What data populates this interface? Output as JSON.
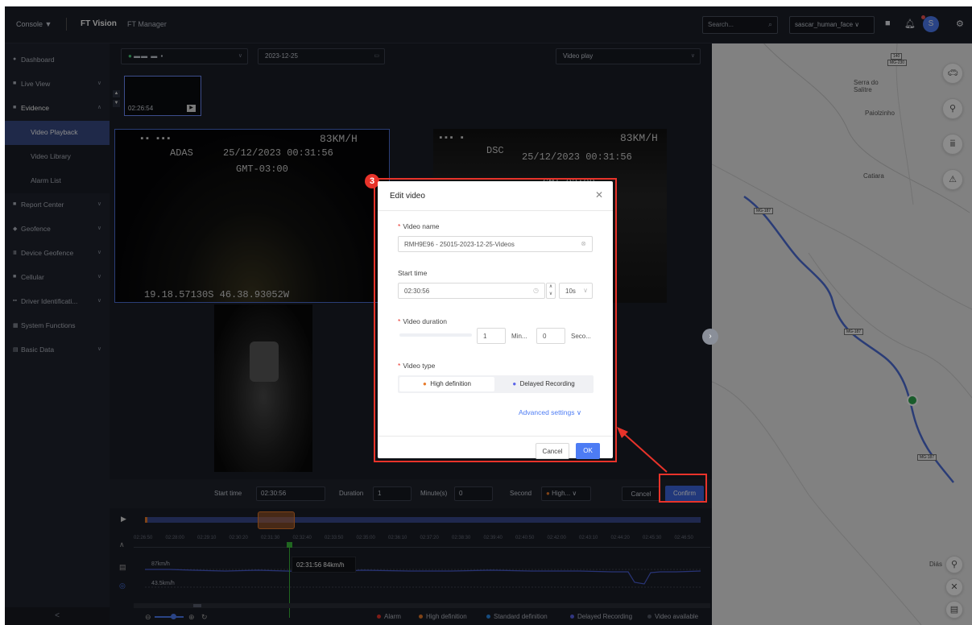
{
  "topbar": {
    "console": "Console ▼",
    "ft_vision": "FT Vision",
    "ft_manager": "FT Manager",
    "search_placeholder": "Search...",
    "user": "sascar_human_face",
    "avatar": "S"
  },
  "sidebar": {
    "items": [
      "Dashboard",
      "Live View",
      "Evidence",
      "Video Playback",
      "Video Library",
      "Alarm List",
      "Report Center",
      "Geofence",
      "Device Geofence",
      "Cellular",
      "Driver Identificati...",
      "System Functions",
      "Basic Data"
    ],
    "collapse": "<"
  },
  "filters": {
    "date": "2023-12-25",
    "mode": "Video play"
  },
  "thumbnail": {
    "time": "02:26:54"
  },
  "videos": {
    "adas": {
      "label": "ADAS",
      "datetime": "25/12/2023 00:31:56",
      "tz": "GMT-03:00",
      "speed": "83KM/H",
      "coords": "19.18.57130S 46.38.93052W"
    },
    "dsc": {
      "label": "DSC",
      "datetime": "25/12/2023 00:31:56",
      "tz": "GMT-03:00",
      "speed": "83KM/H"
    }
  },
  "controls": {
    "start_label": "Start time",
    "start": "02:30:56",
    "duration_label": "Duration",
    "duration": "1",
    "minutes_label": "Minute(s)",
    "seconds": "0",
    "second_label": "Second",
    "type": "High...",
    "cancel": "Cancel",
    "confirm": "Confirm"
  },
  "timeline": {
    "ticks": [
      "02:26:50",
      "02:28:00",
      "02:29:10",
      "02:30:20",
      "02:31:30",
      "02:32:40",
      "02:33:50",
      "02:35:00",
      "02:36:10",
      "02:37:20",
      "02:38:30",
      "02:39:40",
      "02:40:50",
      "02:42:00",
      "02:43:10",
      "02:44:20",
      "02:45:30",
      "02:46:50"
    ],
    "speed_hi": "87km/h",
    "speed_mid": "43.5km/h",
    "tooltip": "02:31:56 84km/h"
  },
  "legend": [
    "Alarm",
    "High definition",
    "Standard definition",
    "Delayed Recording",
    "Video available"
  ],
  "legend_colors": [
    "#e8332a",
    "#e87a2a",
    "#2a8ae8",
    "#5a63e8",
    "#555a66"
  ],
  "map": {
    "labels": [
      "Serra do Salitre",
      "Paiolzinho",
      "Catiara",
      "Diás"
    ],
    "shields": [
      "140",
      "MG-230",
      "MG-187",
      "MG-187",
      "MG-187"
    ]
  },
  "modal": {
    "step": "3",
    "title": "Edit video",
    "name_label": "Video name",
    "name_value": "RMH9E96 - 25015-2023-12-25-Videos",
    "start_label": "Start time",
    "start_value": "02:30:56",
    "step_value": "10s",
    "duration_label": "Video duration",
    "dur_min": "1",
    "dur_min_unit": "Min...",
    "dur_sec": "0",
    "dur_sec_unit": "Seco...",
    "type_label": "Video type",
    "type_hd": "High definition",
    "type_delayed": "Delayed Recording",
    "advanced": "Advanced settings",
    "cancel": "Cancel",
    "ok": "OK"
  }
}
